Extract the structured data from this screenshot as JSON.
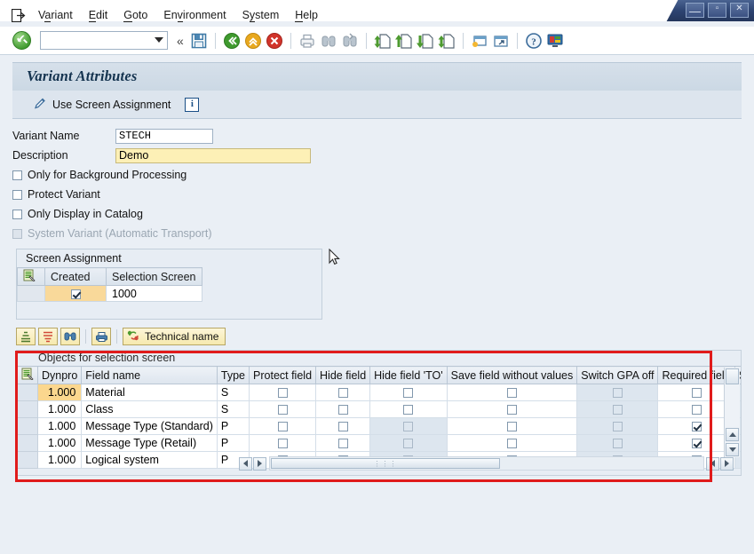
{
  "window": {
    "minimize_label": "—",
    "maximize_label": "▫",
    "close_label": "✕"
  },
  "menubar": {
    "exit_icon": "exit-icon",
    "items": [
      {
        "label": "Variant",
        "mnemonic": "a"
      },
      {
        "label": "Edit",
        "mnemonic": "E"
      },
      {
        "label": "Goto",
        "mnemonic": "G"
      },
      {
        "label": "Environment",
        "mnemonic": "v"
      },
      {
        "label": "System",
        "mnemonic": "y"
      },
      {
        "label": "Help",
        "mnemonic": "H"
      }
    ]
  },
  "toolbar": {
    "enter_icon": "green-check-enter-icon",
    "command_field_value": "",
    "command_field_placeholder": "",
    "dropdown_icon": "chevron-down-icon",
    "expand_icon": "«",
    "icons": [
      "save-icon",
      "back-icon",
      "exit-icon",
      "cancel-icon",
      "print-icon",
      "find-icon",
      "find-next-icon",
      "first-page-icon",
      "previous-page-icon",
      "next-page-icon",
      "last-page-icon",
      "create-session-icon",
      "create-shortcut-icon",
      "help-icon",
      "customize-local-layout-icon"
    ]
  },
  "page": {
    "title": "Variant Attributes",
    "use_screen_assignment_label": "Use Screen Assignment",
    "pencil_icon": "pencil-icon",
    "info_icon": "info-icon",
    "info_label": "i"
  },
  "form": {
    "variant_name_label": "Variant Name",
    "variant_name_value": "STECH",
    "description_label": "Description",
    "description_value": "Demo",
    "checkboxes": [
      {
        "label": "Only for Background Processing",
        "checked": false,
        "disabled": false
      },
      {
        "label": "Protect Variant",
        "checked": false,
        "disabled": false
      },
      {
        "label": "Only Display in Catalog",
        "checked": false,
        "disabled": false
      },
      {
        "label": "System Variant (Automatic Transport)",
        "checked": false,
        "disabled": true
      }
    ]
  },
  "screen_assignment": {
    "title": "Screen Assignment",
    "header_icon": "table-settings-icon",
    "columns": [
      "Created",
      "Selection Screen"
    ],
    "rows": [
      {
        "created": true,
        "selection_screen": "1000"
      }
    ]
  },
  "button_strip": {
    "buttons": [
      {
        "name": "sort-ascending-button",
        "icon": "sort-ascending-icon"
      },
      {
        "name": "sort-descending-button",
        "icon": "sort-descending-icon"
      },
      {
        "name": "find-button",
        "icon": "binoculars-icon"
      },
      {
        "name": "print-button",
        "icon": "print-icon"
      }
    ],
    "technical_name_label": "Technical name",
    "technical_name_icon": "technical-name-toggle-icon"
  },
  "objects_table": {
    "title": "Objects for selection screen",
    "header_icon": "table-settings-icon",
    "columns": [
      "Dynpro",
      "Field name",
      "Type",
      "Protect field",
      "Hide field",
      "Hide field 'TO'",
      "Save field without values",
      "Switch GPA off",
      "Required field",
      "Selection"
    ],
    "rows": [
      {
        "dynpro": "1.000",
        "field_name": "Material",
        "type": "S",
        "protect_field": {
          "checked": false,
          "disabled": false
        },
        "hide_field": {
          "checked": false,
          "disabled": false
        },
        "hide_field_to": {
          "checked": false,
          "disabled": false
        },
        "save_field_without_values": {
          "checked": false,
          "disabled": false
        },
        "switch_gpa_off": {
          "checked": false,
          "disabled": true
        },
        "required_field": {
          "checked": false,
          "disabled": false
        },
        "selected": true
      },
      {
        "dynpro": "1.000",
        "field_name": "Class",
        "type": "S",
        "protect_field": {
          "checked": false,
          "disabled": false
        },
        "hide_field": {
          "checked": false,
          "disabled": false
        },
        "hide_field_to": {
          "checked": false,
          "disabled": false
        },
        "save_field_without_values": {
          "checked": false,
          "disabled": false
        },
        "switch_gpa_off": {
          "checked": false,
          "disabled": true
        },
        "required_field": {
          "checked": false,
          "disabled": false
        },
        "selected": false
      },
      {
        "dynpro": "1.000",
        "field_name": "Message Type (Standard)",
        "type": "P",
        "protect_field": {
          "checked": false,
          "disabled": false
        },
        "hide_field": {
          "checked": false,
          "disabled": false
        },
        "hide_field_to": {
          "checked": false,
          "disabled": true
        },
        "save_field_without_values": {
          "checked": false,
          "disabled": false
        },
        "switch_gpa_off": {
          "checked": false,
          "disabled": true
        },
        "required_field": {
          "checked": true,
          "disabled": false
        },
        "selected": false
      },
      {
        "dynpro": "1.000",
        "field_name": "Message Type (Retail)",
        "type": "P",
        "protect_field": {
          "checked": false,
          "disabled": false
        },
        "hide_field": {
          "checked": false,
          "disabled": false
        },
        "hide_field_to": {
          "checked": false,
          "disabled": true
        },
        "save_field_without_values": {
          "checked": false,
          "disabled": false
        },
        "switch_gpa_off": {
          "checked": false,
          "disabled": true
        },
        "required_field": {
          "checked": true,
          "disabled": false
        },
        "selected": false
      },
      {
        "dynpro": "1.000",
        "field_name": "Logical system",
        "type": "P",
        "protect_field": {
          "checked": false,
          "disabled": false
        },
        "hide_field": {
          "checked": false,
          "disabled": false
        },
        "hide_field_to": {
          "checked": false,
          "disabled": true
        },
        "save_field_without_values": {
          "checked": false,
          "disabled": false
        },
        "switch_gpa_off": {
          "checked": false,
          "disabled": true
        },
        "required_field": {
          "checked": false,
          "disabled": false
        },
        "selected": false
      }
    ],
    "vertical_scrollbar": {
      "up_icon": "arrow-up-icon",
      "down_icon": "arrow-down-icon"
    },
    "horizontal_scrollbar": {
      "left_icon": "arrow-left-icon",
      "right_icon": "arrow-right-icon",
      "grip": "⋮⋮⋮"
    }
  },
  "annotation": {
    "highlight_color": "#e01b1b"
  },
  "colors": {
    "body_background": "#eaeff5",
    "header_band": "#d6e0ea",
    "required_field_yellow": "#fdf0b6",
    "created_cell_yellow": "#f9d99a",
    "selected_cell_orange": "#fbd78e"
  }
}
